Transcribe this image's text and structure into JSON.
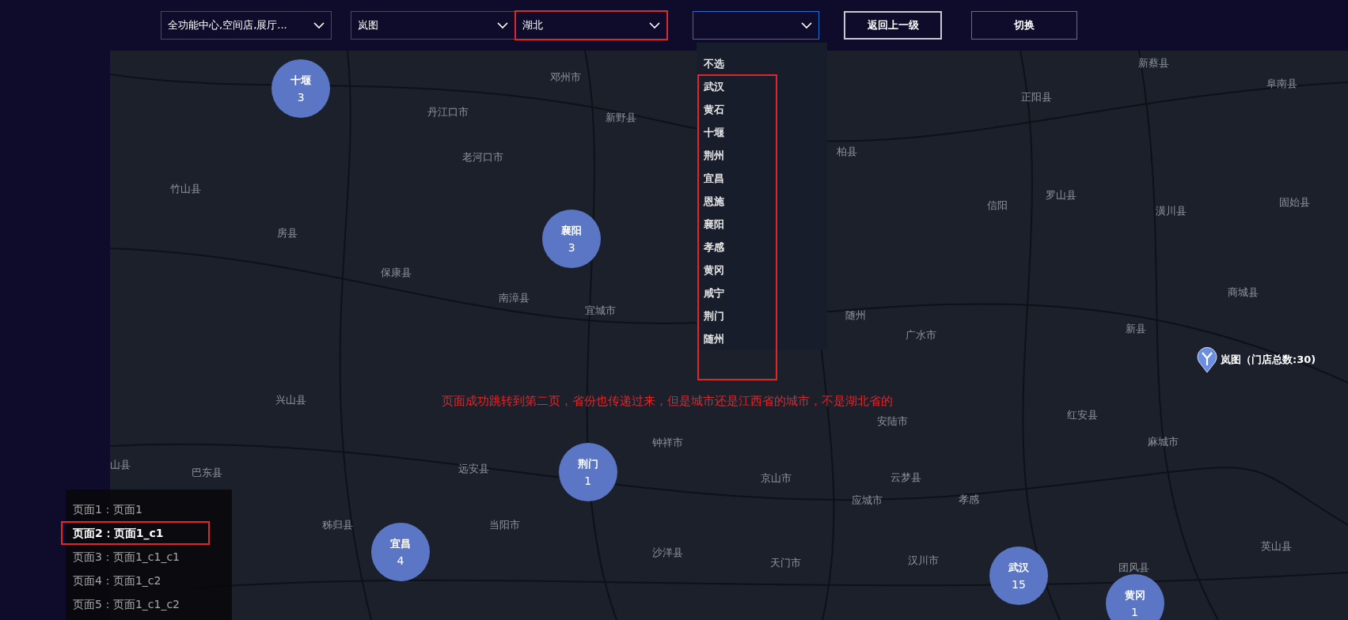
{
  "filters": [
    {
      "kind": "select",
      "value": "全功能中心,空间店,展厅...",
      "highlighted": false,
      "focused": false
    },
    {
      "kind": "select",
      "value": "岚图",
      "highlighted": false,
      "focused": false
    },
    {
      "kind": "select",
      "value": "湖北",
      "highlighted": true,
      "focused": false
    },
    {
      "kind": "select",
      "highlighted": false,
      "focused": true
    }
  ],
  "buttons": [
    "返回上一级",
    "切换"
  ],
  "dropdown": {
    "highlighted": true,
    "options": [
      "不选",
      "武汉",
      "黄石",
      "十堰",
      "荆州",
      "宜昌",
      "恩施",
      "襄阳",
      "孝感",
      "黄冈",
      "咸宁",
      "荆门",
      "随州"
    ]
  },
  "map": {
    "place_labels": [
      "邓州市",
      "丹江口市",
      "新野县",
      "老河口市",
      "竹山县",
      "房县",
      "保康县",
      "南漳县",
      "宜城市",
      "兴山县",
      "巴东县",
      "远安县",
      "钟祥市",
      "秭归县",
      "当阳市",
      "沙洋县",
      "京山市",
      "天门市",
      "汉川市",
      "应城市",
      "云梦县",
      "孝感",
      "安陆市",
      "随州",
      "广水市",
      "信阳",
      "罗山县",
      "正阳县",
      "新蔡县",
      "阜南县",
      "潢川县",
      "固始县",
      "商城县",
      "新县",
      "红安县",
      "麻城市",
      "团风县",
      "英山县",
      "柏县",
      "山县"
    ],
    "clusters": [
      {
        "name": "十堰",
        "count": "3"
      },
      {
        "name": "襄阳",
        "count": "3"
      },
      {
        "name": "荆门",
        "count": "1"
      },
      {
        "name": "宜昌",
        "count": "4"
      },
      {
        "name": "武汉",
        "count": "15"
      },
      {
        "name": "黄冈",
        "count": "1"
      }
    ],
    "marker": {
      "label": "岚图（门店总数:30)"
    },
    "note": "页面成功跳转到第二页，省份也传递过来，但是城市还是江西省的城市，不是湖北省的"
  },
  "pages": [
    {
      "label": "页面1：页面1",
      "selected": false
    },
    {
      "label": "页面2：页面1_c1",
      "selected": true
    },
    {
      "label": "页面3：页面1_c1_c1",
      "selected": false
    },
    {
      "label": "页面4：页面1_c2",
      "selected": false
    },
    {
      "label": "页面5：页面1_c1_c2",
      "selected": false
    }
  ]
}
